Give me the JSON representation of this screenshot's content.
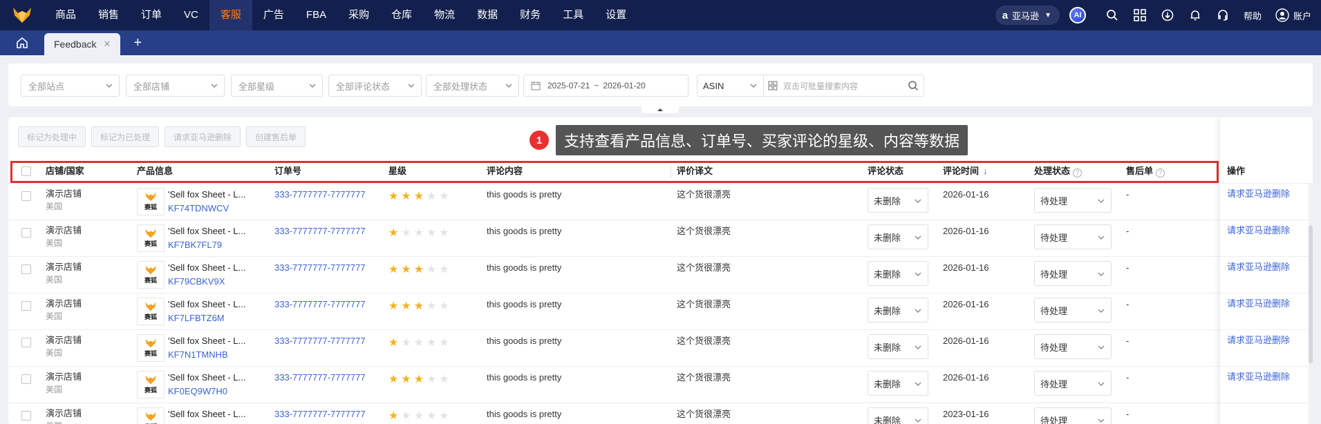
{
  "nav": {
    "items": [
      "商品",
      "销售",
      "订单",
      "VC",
      "客服",
      "广告",
      "FBA",
      "采购",
      "仓库",
      "物流",
      "数据",
      "财务",
      "工具",
      "设置"
    ],
    "active_index": 4,
    "marketplace": "亚马逊",
    "ai_label": "AI",
    "help": "帮助",
    "account": "账户"
  },
  "tabs": {
    "current": "Feedback"
  },
  "filters": {
    "site": "全部站点",
    "shop": "全部店铺",
    "rating": "全部星级",
    "review_status": "全部评论状态",
    "process_status": "全部处理状态",
    "date_start": "2025-07-21",
    "date_sep": "~",
    "date_end": "2026-01-20",
    "search_type": "ASIN",
    "search_placeholder": "双击可批量搜索内容"
  },
  "actions": {
    "mark_processing": "标记为处理中",
    "mark_processed": "标记为已处理",
    "request_delete": "请求亚马逊删除",
    "create_aftersale": "创建售后单"
  },
  "tooltip": {
    "number": "1",
    "text": "支持查看产品信息、订单号、买家评论的星级、内容等数据"
  },
  "columns": {
    "shop": "店铺/国家",
    "product": "产品信息",
    "order": "订单号",
    "rating": "星级",
    "content": "评论内容",
    "translation": "评价译文",
    "review_status": "评论状态",
    "review_time": "评论时间",
    "process_status": "处理状态",
    "aftersale": "售后单",
    "operation": "操作"
  },
  "thumb_label": "赛狐",
  "rows": [
    {
      "shop": "演示店铺",
      "country": "美国",
      "title": "'Sell fox Sheet - L...",
      "code": "KF74TDNWCV",
      "order": "333-7777777-7777777",
      "stars": 3,
      "content": "this goods is pretty",
      "translation": "这个货很漂亮",
      "review_status": "未删除",
      "date": "2026-01-16",
      "process": "待处理",
      "aftersale": "-",
      "op": "请求亚马逊删除"
    },
    {
      "shop": "演示店铺",
      "country": "美国",
      "title": "'Sell fox Sheet - L...",
      "code": "KF7BK7FL79",
      "order": "333-7777777-7777777",
      "stars": 1,
      "content": "this goods is pretty",
      "translation": "这个货很漂亮",
      "review_status": "未删除",
      "date": "2026-01-16",
      "process": "待处理",
      "aftersale": "-",
      "op": "请求亚马逊删除"
    },
    {
      "shop": "演示店铺",
      "country": "美国",
      "title": "'Sell fox Sheet - L...",
      "code": "KF79CBKV9X",
      "order": "333-7777777-7777777",
      "stars": 3,
      "content": "this goods is pretty",
      "translation": "这个货很漂亮",
      "review_status": "未删除",
      "date": "2026-01-16",
      "process": "待处理",
      "aftersale": "-",
      "op": "请求亚马逊删除"
    },
    {
      "shop": "演示店铺",
      "country": "美国",
      "title": "'Sell fox Sheet - L...",
      "code": "KF7LFBTZ6M",
      "order": "333-7777777-7777777",
      "stars": 3,
      "content": "this goods is pretty",
      "translation": "这个货很漂亮",
      "review_status": "未删除",
      "date": "2026-01-16",
      "process": "待处理",
      "aftersale": "-",
      "op": "请求亚马逊删除"
    },
    {
      "shop": "演示店铺",
      "country": "美国",
      "title": "'Sell fox Sheet - L...",
      "code": "KF7N1TMNHB",
      "order": "333-7777777-7777777",
      "stars": 1,
      "content": "this goods is pretty",
      "translation": "这个货很漂亮",
      "review_status": "未删除",
      "date": "2026-01-16",
      "process": "待处理",
      "aftersale": "-",
      "op": "请求亚马逊删除"
    },
    {
      "shop": "演示店铺",
      "country": "美国",
      "title": "'Sell fox Sheet - L...",
      "code": "KF0EQ9W7H0",
      "order": "333-7777777-7777777",
      "stars": 3,
      "content": "this goods is pretty",
      "translation": "这个货很漂亮",
      "review_status": "未删除",
      "date": "2026-01-16",
      "process": "待处理",
      "aftersale": "-",
      "op": "请求亚马逊删除"
    },
    {
      "shop": "演示店铺",
      "country": "美国",
      "title": "'Sell fox Sheet - L...",
      "code": "",
      "order": "333-7777777-7777777",
      "stars": 1,
      "content": "this goods is pretty",
      "translation": "这个货很漂亮",
      "review_status": "未删除",
      "date": "2023-01-16",
      "process": "待处理",
      "aftersale": "-",
      "op": ""
    }
  ],
  "colors": {
    "nav_bg": "#13204d",
    "tab_bg": "#263f87",
    "accent": "#ff7d1a",
    "link": "#3a62d8",
    "star": "#f5b21b",
    "highlight": "#e12f2f"
  }
}
